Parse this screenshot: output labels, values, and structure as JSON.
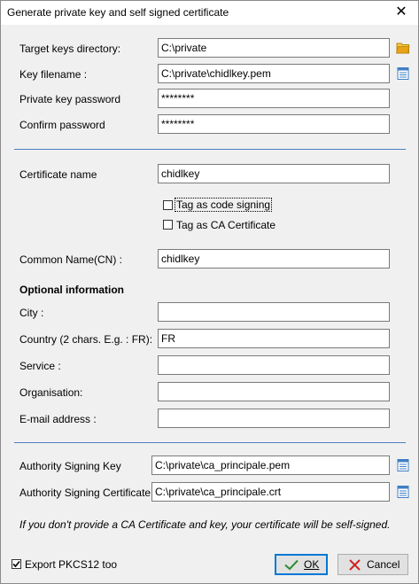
{
  "window": {
    "title": "Generate private key and self signed certificate"
  },
  "fields": {
    "target_dir": {
      "label": "Target keys directory:",
      "value": "C:\\private"
    },
    "key_filename": {
      "label": "Key filename :",
      "value": "C:\\private\\chidlkey.pem"
    },
    "private_password": {
      "label": "Private key password",
      "value": "********"
    },
    "confirm_password": {
      "label": "Confirm password",
      "value": "********"
    },
    "cert_name": {
      "label": "Certificate name",
      "value": "chidlkey"
    },
    "common_name": {
      "label": "Common Name(CN) :",
      "value": "chidlkey"
    },
    "city": {
      "label": "City :",
      "value": ""
    },
    "country": {
      "label": "Country (2 chars. E.g. : FR):",
      "value": "FR"
    },
    "service": {
      "label": "Service :",
      "value": ""
    },
    "organisation": {
      "label": "Organisation:",
      "value": ""
    },
    "email": {
      "label": "E-mail address :",
      "value": ""
    },
    "auth_key": {
      "label": "Authority Signing Key",
      "value": "C:\\private\\ca_principale.pem"
    },
    "auth_cert": {
      "label": "Authority Signing Certificate",
      "value": "C:\\private\\ca_principale.crt"
    }
  },
  "checkboxes": {
    "code_signing": {
      "label": "Tag as code signing",
      "checked": false
    },
    "ca_cert": {
      "label": "Tag as CA Certificate",
      "checked": false
    },
    "export_pkcs12": {
      "label": "Export PKCS12 too",
      "checked": true
    }
  },
  "optional_header": "Optional information",
  "note": "If you don't provide a CA Certificate and key, your certificate will be self-signed.",
  "buttons": {
    "ok": "OK",
    "cancel": "Cancel"
  },
  "icons": {
    "folder": "folder-open-icon",
    "file": "file-list-icon",
    "ok": "checkmark-icon",
    "cancel": "cross-icon"
  },
  "colors": {
    "separator": "#4f7fbf",
    "folder": "#e8a317",
    "file": "#3f7fc4",
    "ok_check": "#2e8b2e",
    "cancel_x": "#cc2222"
  }
}
